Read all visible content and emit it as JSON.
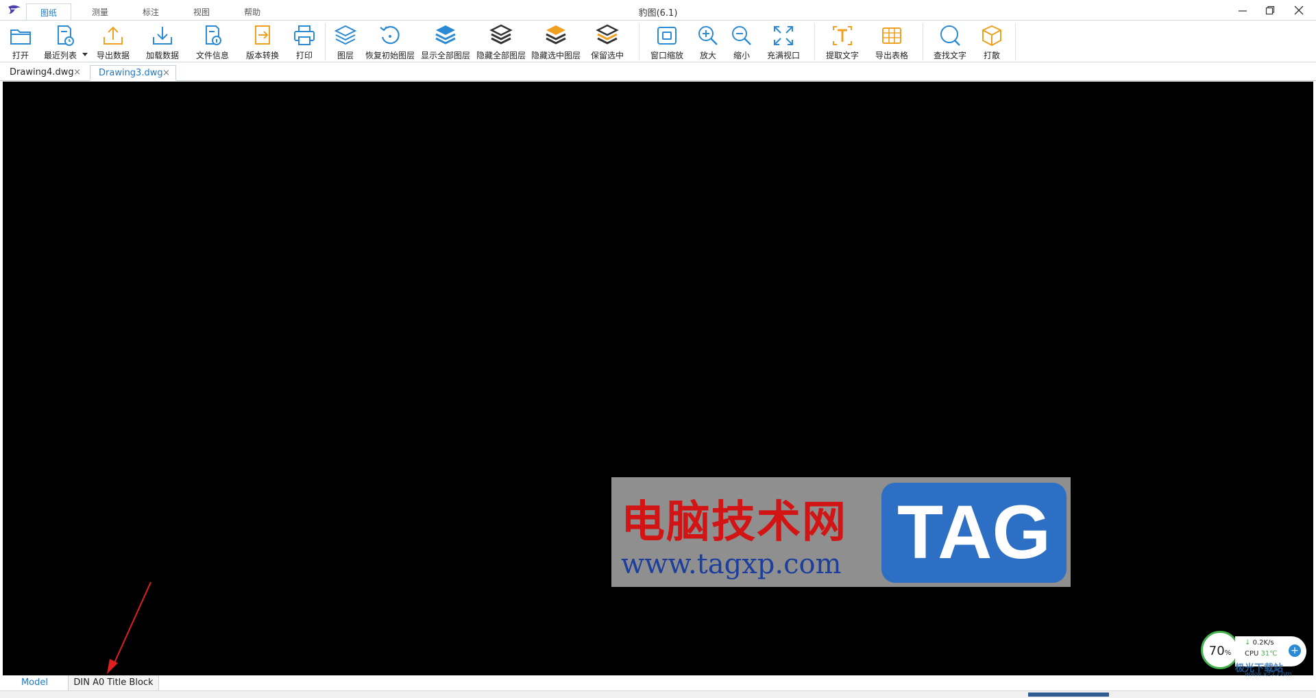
{
  "window": {
    "title": "豹图(6.1)"
  },
  "ribbon_tabs": [
    {
      "label": "图纸",
      "active": true
    },
    {
      "label": "测量"
    },
    {
      "label": "标注"
    },
    {
      "label": "视图"
    },
    {
      "label": "帮助"
    }
  ],
  "toolbar": {
    "open": "打开",
    "recent": "最近列表",
    "export_data": "导出数据",
    "load_data": "加载数据",
    "file_info": "文件信息",
    "version_convert": "版本转换",
    "print": "打印",
    "layers": "图层",
    "restore_layers": "恢复初始图层",
    "show_all_layers": "显示全部图层",
    "hide_all_layers": "隐藏全部图层",
    "hide_selected_layers": "隐藏选中图层",
    "keep_selected": "保留选中",
    "window_zoom": "窗口缩放",
    "zoom_in": "放大",
    "zoom_out": "缩小",
    "fill_view": "充满视口",
    "extract_text": "提取文字",
    "export_table": "导出表格",
    "find_text": "查找文字",
    "explode": "打散"
  },
  "doc_tabs": [
    {
      "label": "Drawing4.dwg",
      "active": false
    },
    {
      "label": "Drawing3.dwg",
      "active": true
    }
  ],
  "layout_tabs": [
    {
      "label": "Model",
      "active": true
    },
    {
      "label": "DIN A0 Title Block",
      "active": false
    }
  ],
  "watermark": {
    "site_name": "电脑技术网",
    "url": "www.tagxp.com",
    "badge": "TAG"
  },
  "system_widget": {
    "percent": "70",
    "percent_unit": "%",
    "net_speed": "0.2K/s",
    "cpu_label": "CPU",
    "cpu_temp": "31℃",
    "site_mark": "极光下载站",
    "site_url": "www.xz7.com"
  },
  "colors": {
    "accent": "#1f78c8",
    "icon_blue": "#2a8ad4",
    "icon_orange": "#f0a020",
    "canvas": "#000000"
  }
}
